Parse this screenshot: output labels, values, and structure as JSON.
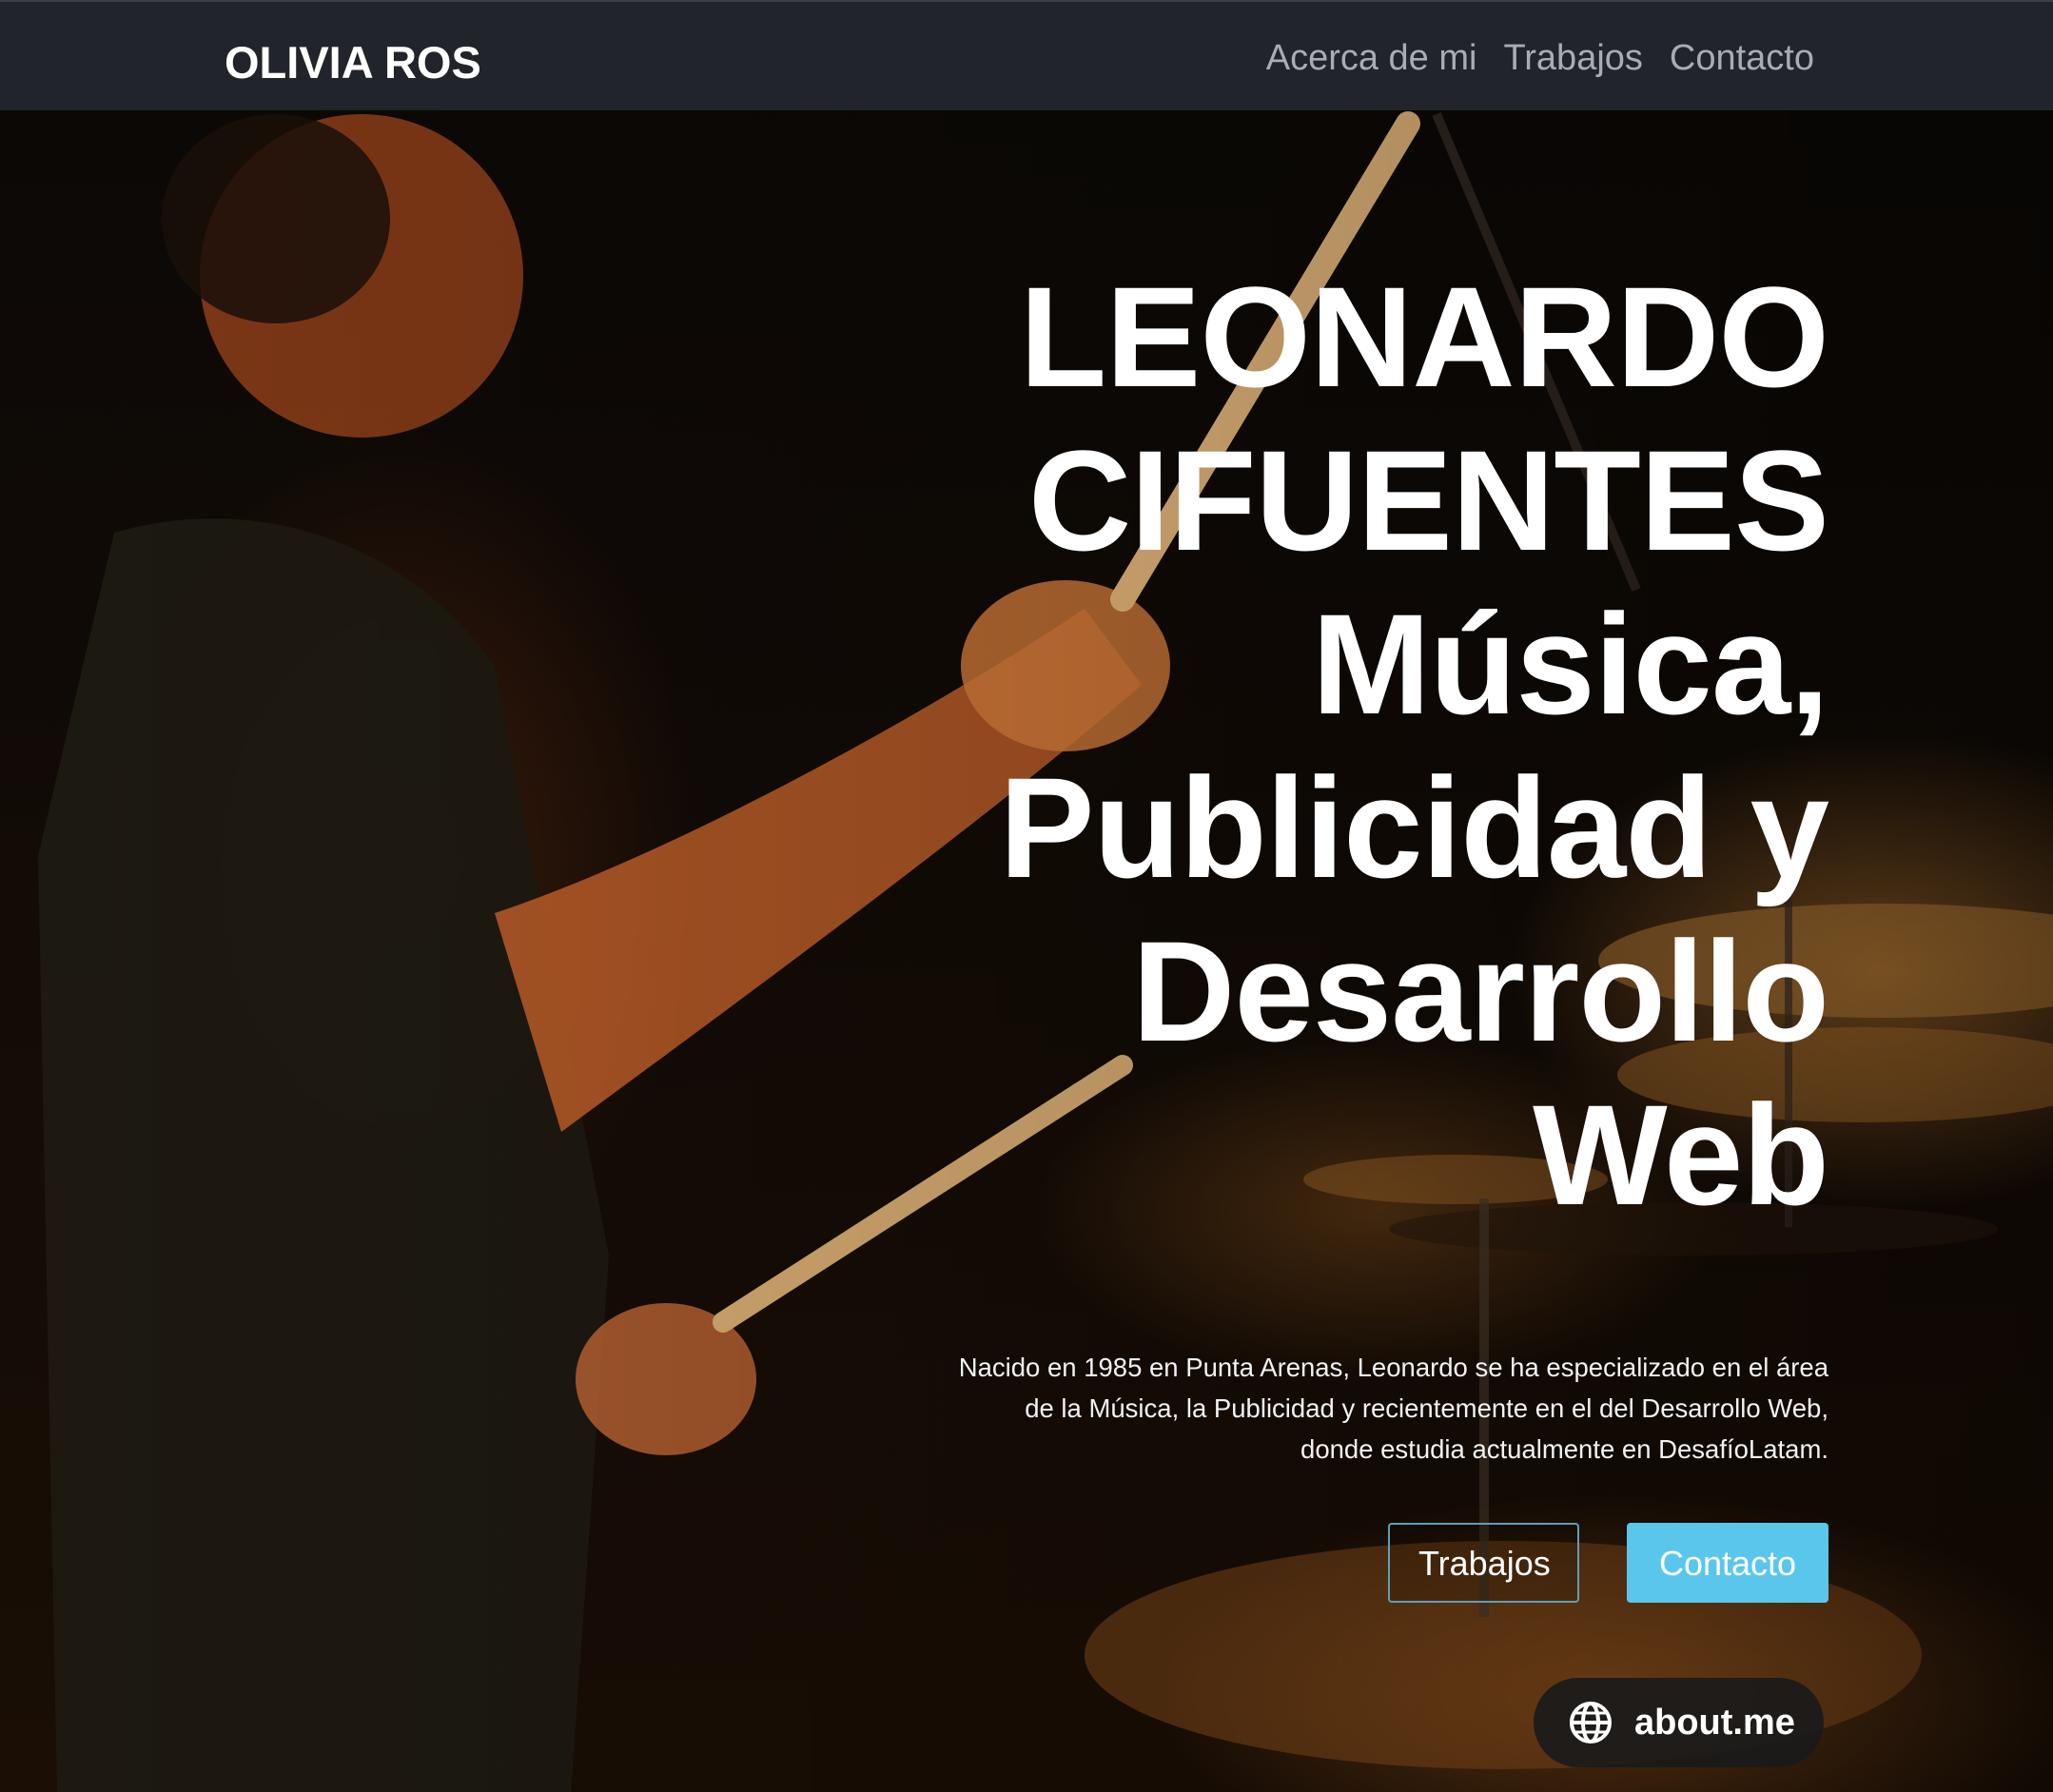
{
  "navbar": {
    "brand": "OLIVIA ROS",
    "links": [
      "Acerca de mi",
      "Trabajos",
      "Contacto"
    ]
  },
  "hero": {
    "background_image": "drummer-photo",
    "title_lines": [
      "LEONARDO",
      "CIFUENTES",
      "Música,",
      "Publicidad y",
      "Desarrollo",
      "Web"
    ],
    "description_lines": [
      "Nacido en 1985 en Punta Arenas, Leonardo se ha especializado en el área",
      "de la Música, la Publicidad y recientemente en el del Desarrollo Web,",
      "donde estudia actualmente en DesafíoLatam."
    ],
    "buttons": {
      "trabajos": "Trabajos",
      "contacto": "Contacto"
    }
  },
  "badge": {
    "icon": "globe-icon",
    "label": "about.me"
  },
  "colors": {
    "navbar_bg": "#21252b",
    "nav_link": "#a9adb3",
    "accent_button": "#5bc6ec",
    "outline_border": "#5f9fb6"
  }
}
